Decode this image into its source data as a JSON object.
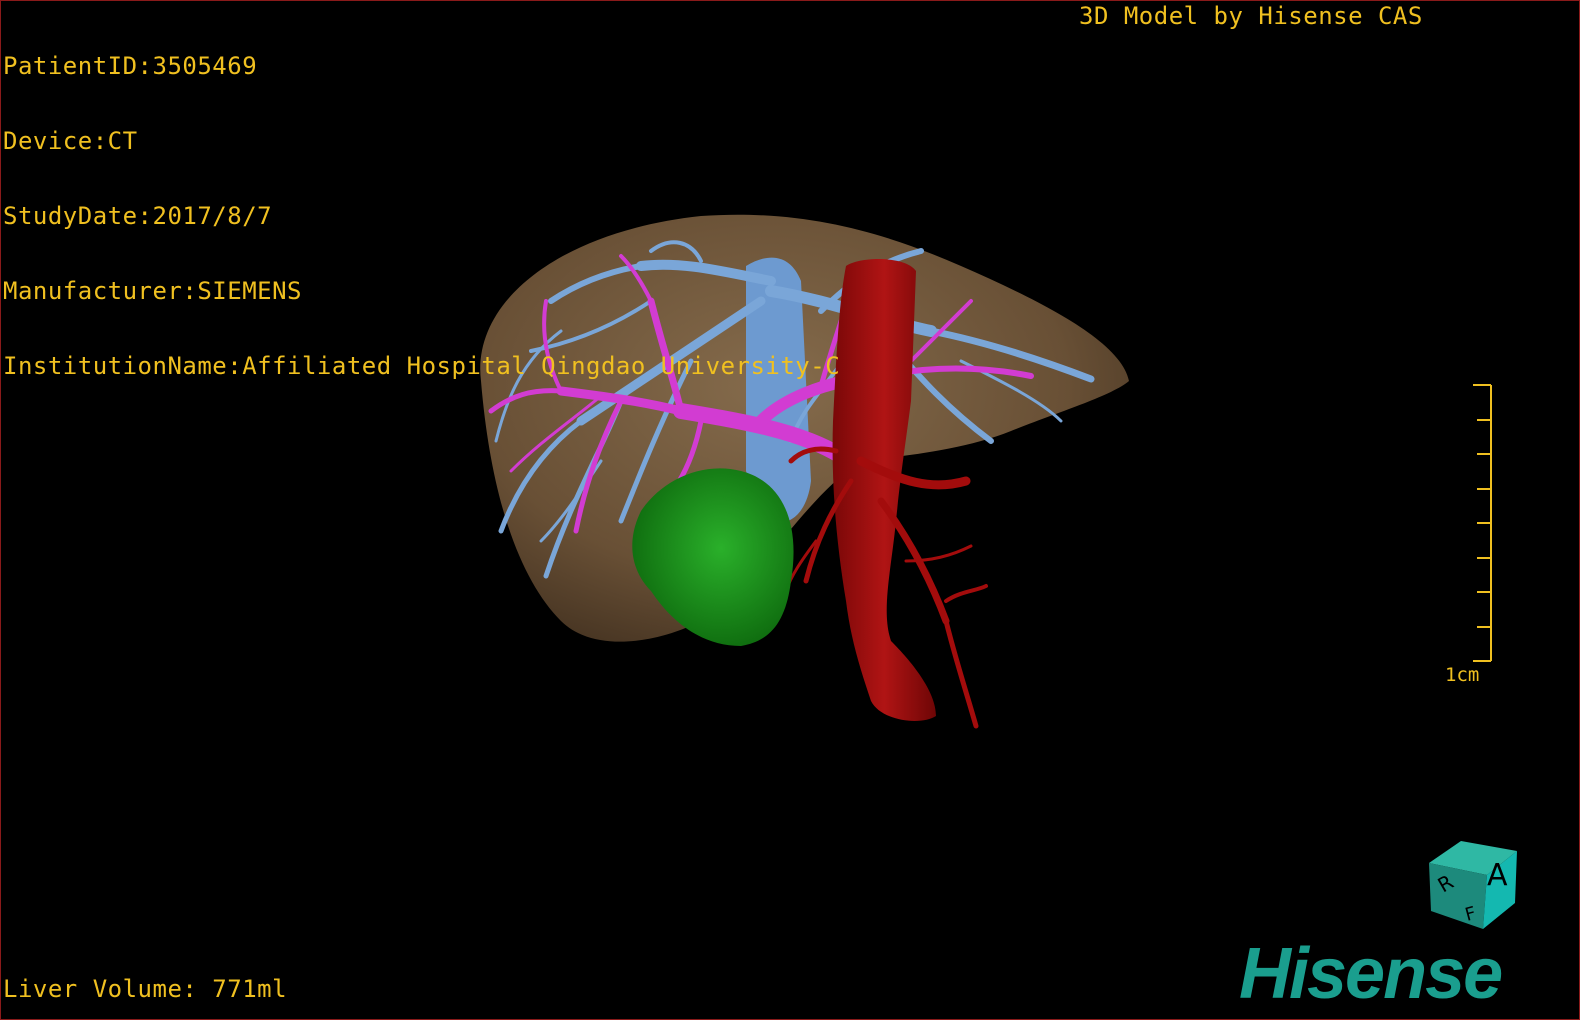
{
  "header_info": {
    "patient_id": "PatientID:3505469",
    "device": "Device:CT",
    "study_date": "StudyDate:2017/8/7",
    "manufacturer": "Manufacturer:SIEMENS",
    "institution": "InstitutionName:Affiliated Hospital Qingdao University-C"
  },
  "model_credit": "3D Model by Hisense CAS",
  "liver_volume": "Liver Volume: 771ml",
  "scale_bar": {
    "label": "1cm"
  },
  "orientation_cube": {
    "front_face": "A",
    "side_face": "R",
    "bottom_face": "F"
  },
  "brand": "Hisense",
  "colors": {
    "overlay_text": "#f0c020",
    "liver": "#8a6e4e",
    "hepatic_vein": "#7aa6d8",
    "portal_vein": "#d23cd2",
    "artery_ivc": "#a30c0c",
    "tumor": "#1e9a1e",
    "brand": "#1a9e8e"
  }
}
